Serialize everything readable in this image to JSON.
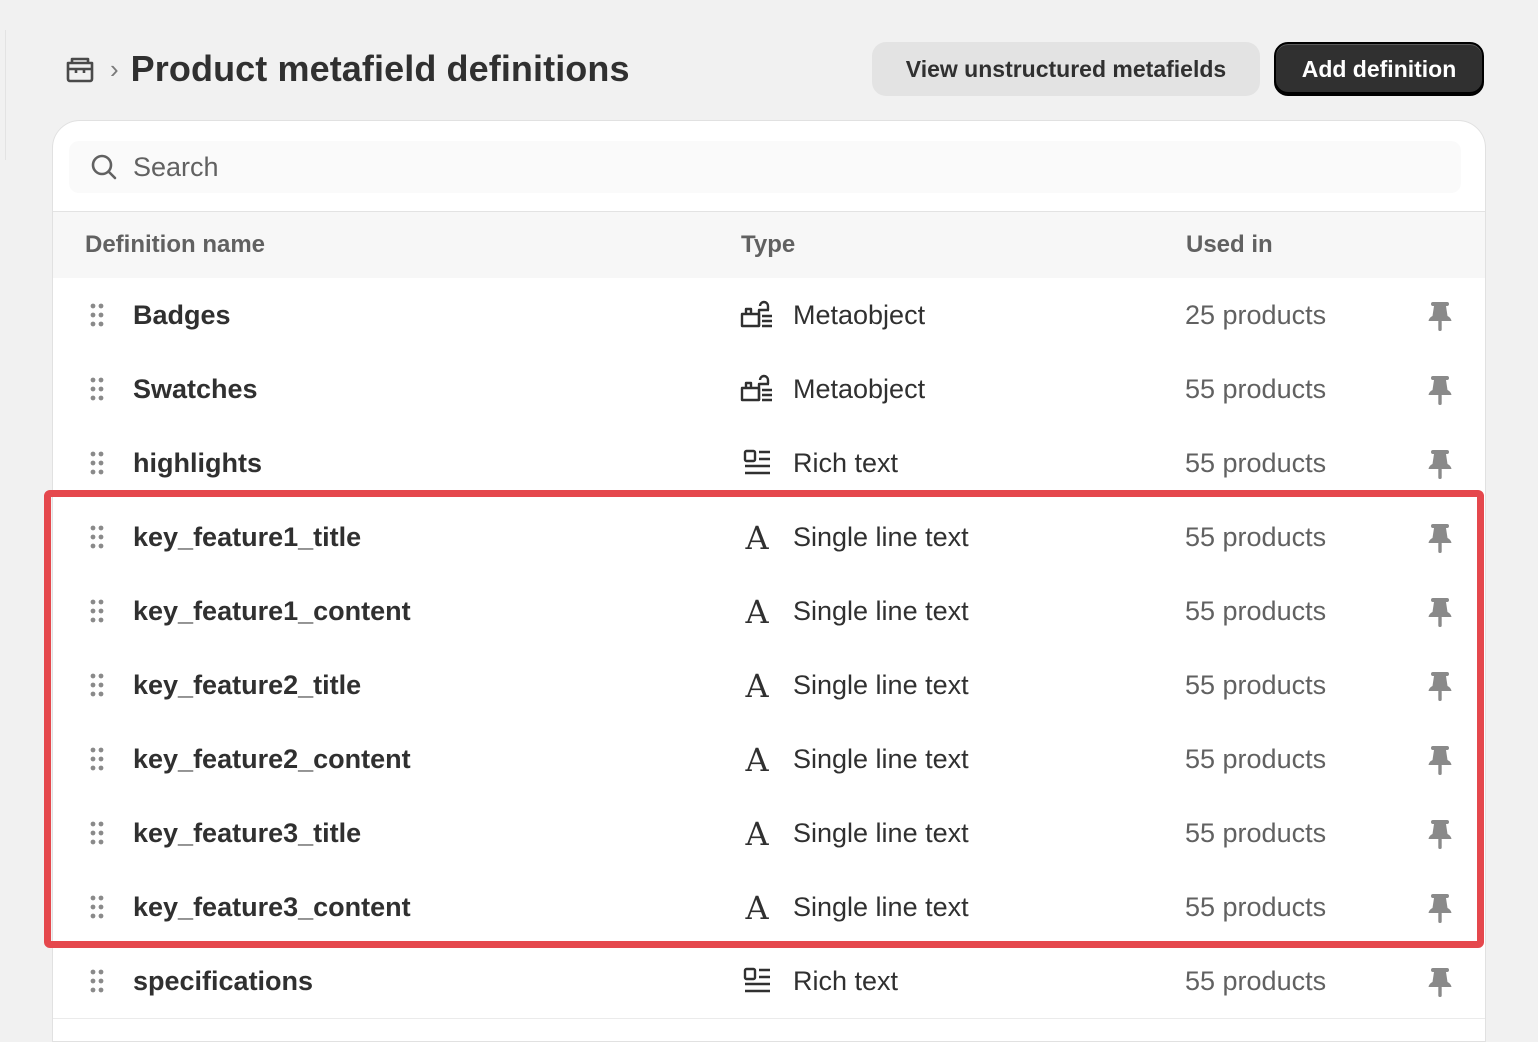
{
  "header": {
    "breadcrumb_icon": "store-icon",
    "title": "Product metafield definitions",
    "secondary_button": "View unstructured metafields",
    "primary_button": "Add definition"
  },
  "search": {
    "placeholder": "Search",
    "value": ""
  },
  "table": {
    "columns": [
      "Definition name",
      "Type",
      "Used in"
    ],
    "rows": [
      {
        "name": "Badges",
        "type": "Metaobject",
        "type_icon": "metaobject-icon",
        "used_in": "25 products"
      },
      {
        "name": "Swatches",
        "type": "Metaobject",
        "type_icon": "metaobject-icon",
        "used_in": "55 products"
      },
      {
        "name": "highlights",
        "type": "Rich text",
        "type_icon": "rich-text-icon",
        "used_in": "55 products"
      },
      {
        "name": "key_feature1_title",
        "type": "Single line text",
        "type_icon": "text-icon",
        "used_in": "55 products"
      },
      {
        "name": "key_feature1_content",
        "type": "Single line text",
        "type_icon": "text-icon",
        "used_in": "55 products"
      },
      {
        "name": "key_feature2_title",
        "type": "Single line text",
        "type_icon": "text-icon",
        "used_in": "55 products"
      },
      {
        "name": "key_feature2_content",
        "type": "Single line text",
        "type_icon": "text-icon",
        "used_in": "55 products"
      },
      {
        "name": "key_feature3_title",
        "type": "Single line text",
        "type_icon": "text-icon",
        "used_in": "55 products"
      },
      {
        "name": "key_feature3_content",
        "type": "Single line text",
        "type_icon": "text-icon",
        "used_in": "55 products"
      },
      {
        "name": "specifications",
        "type": "Rich text",
        "type_icon": "rich-text-icon",
        "used_in": "55 products"
      }
    ]
  },
  "colors": {
    "highlight": "#e5484d",
    "primary_button": "#303030",
    "page_bg": "#f1f1f1"
  }
}
